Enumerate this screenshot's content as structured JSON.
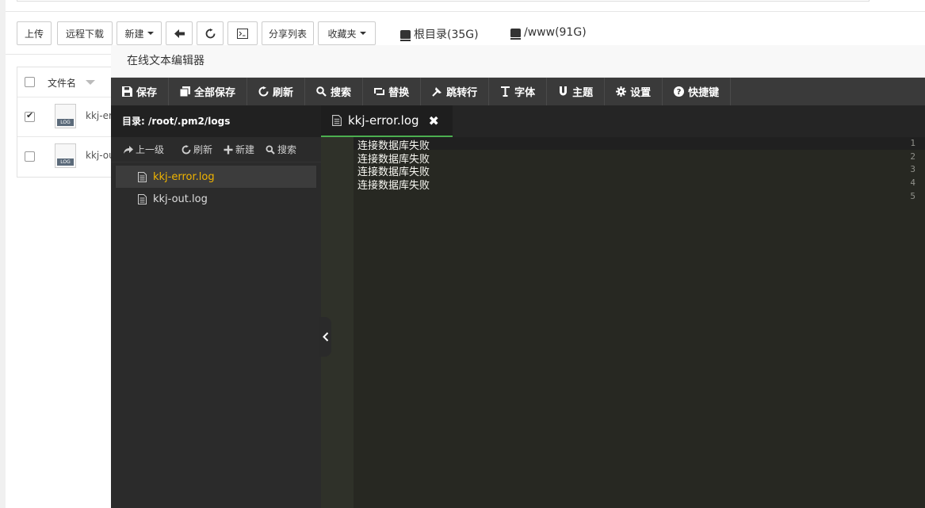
{
  "toolbar": {
    "upload": "上传",
    "remote_download": "远程下载",
    "new": "新建",
    "share_list": "分享列表",
    "favorites": "收藏夹"
  },
  "disks": [
    {
      "label": "根目录(35G)"
    },
    {
      "label": "/www(91G)"
    }
  ],
  "file_table": {
    "header_name": "文件名",
    "rows": [
      {
        "name": "kkj-err",
        "checked": true
      },
      {
        "name": "kkj-out",
        "checked": false
      }
    ],
    "file_tag": "LOG"
  },
  "editor": {
    "title": "在线文本编辑器",
    "tools": [
      {
        "label": "保存",
        "icon": "save-icon"
      },
      {
        "label": "全部保存",
        "icon": "save-all-icon"
      },
      {
        "label": "刷新",
        "icon": "refresh-icon"
      },
      {
        "label": "搜索",
        "icon": "search-icon"
      },
      {
        "label": "替换",
        "icon": "replace-icon"
      },
      {
        "label": "跳转行",
        "icon": "goto-line-icon"
      },
      {
        "label": "字体",
        "icon": "font-icon"
      },
      {
        "label": "主题",
        "icon": "theme-icon"
      },
      {
        "label": "设置",
        "icon": "gear-icon"
      },
      {
        "label": "快捷键",
        "icon": "help-icon"
      }
    ],
    "directory_label": "目录:",
    "directory_path": "/root/.pm2/logs",
    "side_actions": {
      "up": "上一级",
      "refresh": "刷新",
      "new": "新建",
      "search": "搜索"
    },
    "files": [
      {
        "name": "kkj-error.log",
        "active": true
      },
      {
        "name": "kkj-out.log",
        "active": false
      }
    ],
    "tab": {
      "name": "kkj-error.log"
    },
    "lines": [
      {
        "no": "1",
        "text": "连接数据库失败"
      },
      {
        "no": "2",
        "text": "连接数据库失败"
      },
      {
        "no": "3",
        "text": "连接数据库失败"
      },
      {
        "no": "4",
        "text": "连接数据库失败"
      },
      {
        "no": "5",
        "text": ""
      }
    ],
    "colors": {
      "active_file": "#f0b400",
      "tab_underline": "#4caf50",
      "editor_bg": "#272822"
    }
  }
}
